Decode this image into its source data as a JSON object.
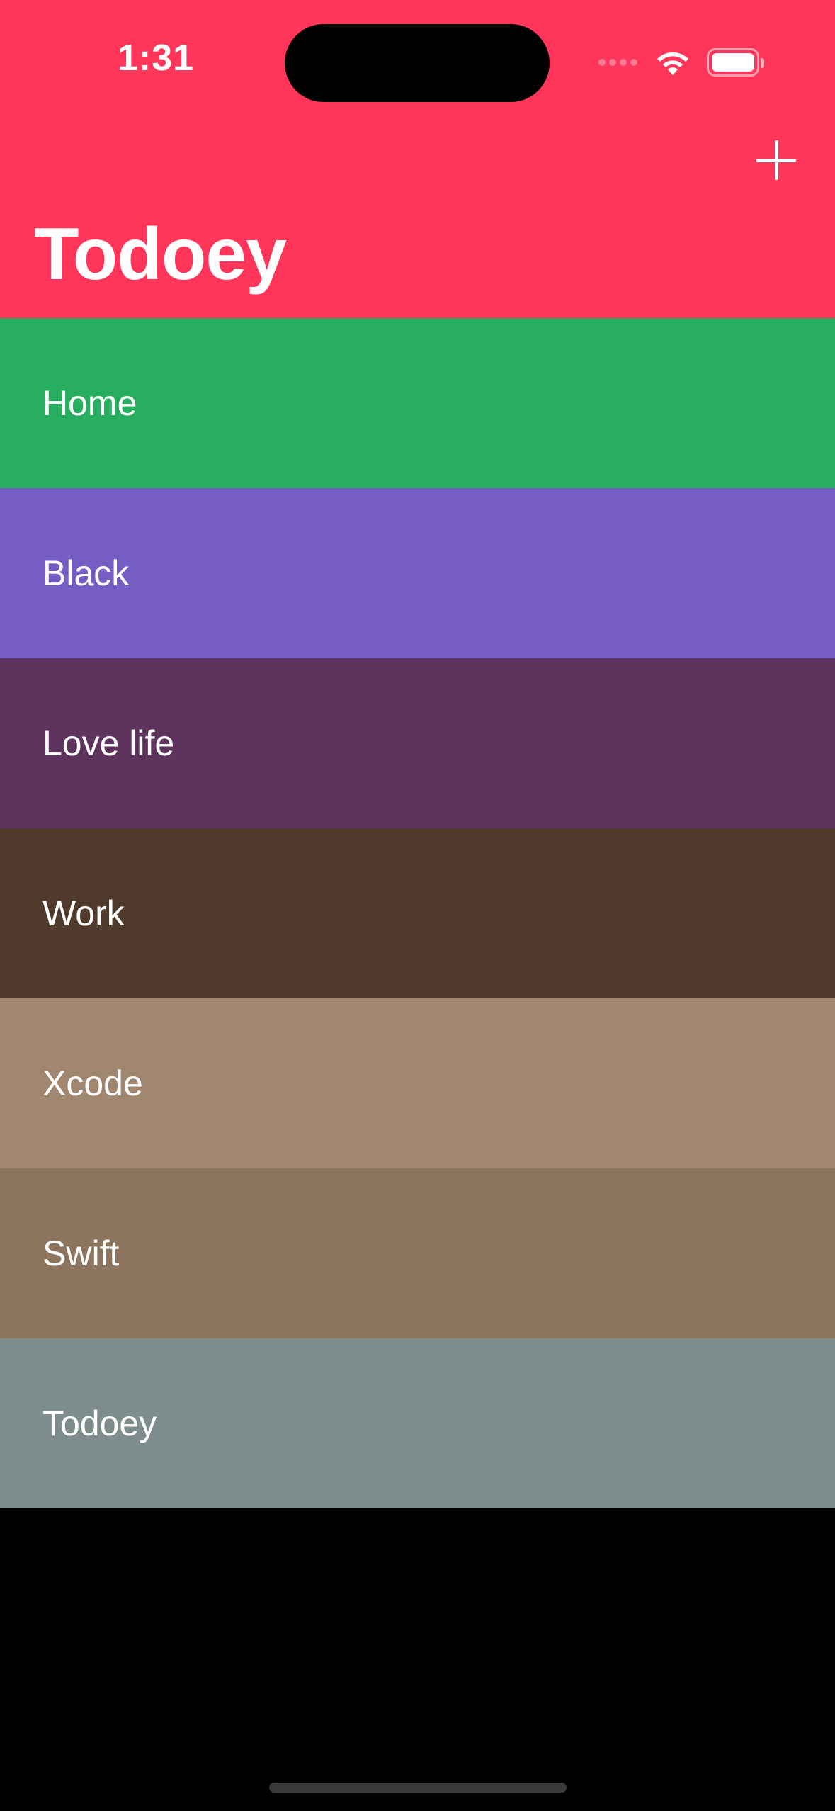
{
  "status_bar": {
    "time": "1:31",
    "wifi_icon": "wifi-icon",
    "battery_icon": "battery-icon"
  },
  "nav": {
    "title": "Todoey",
    "add_icon": "plus-icon",
    "background_color": "#FF3659"
  },
  "categories": [
    {
      "name": "Home",
      "color": "#27AE60"
    },
    {
      "name": "Black",
      "color": "#765DC3"
    },
    {
      "name": "Love life",
      "color": "#5E345E"
    },
    {
      "name": "Work",
      "color": "#4F3A2C"
    },
    {
      "name": "Xcode",
      "color": "#A28770"
    },
    {
      "name": "Swift",
      "color": "#8D745E"
    },
    {
      "name": "Todoey",
      "color": "#7E8C8B"
    }
  ],
  "background_color": "#000000"
}
